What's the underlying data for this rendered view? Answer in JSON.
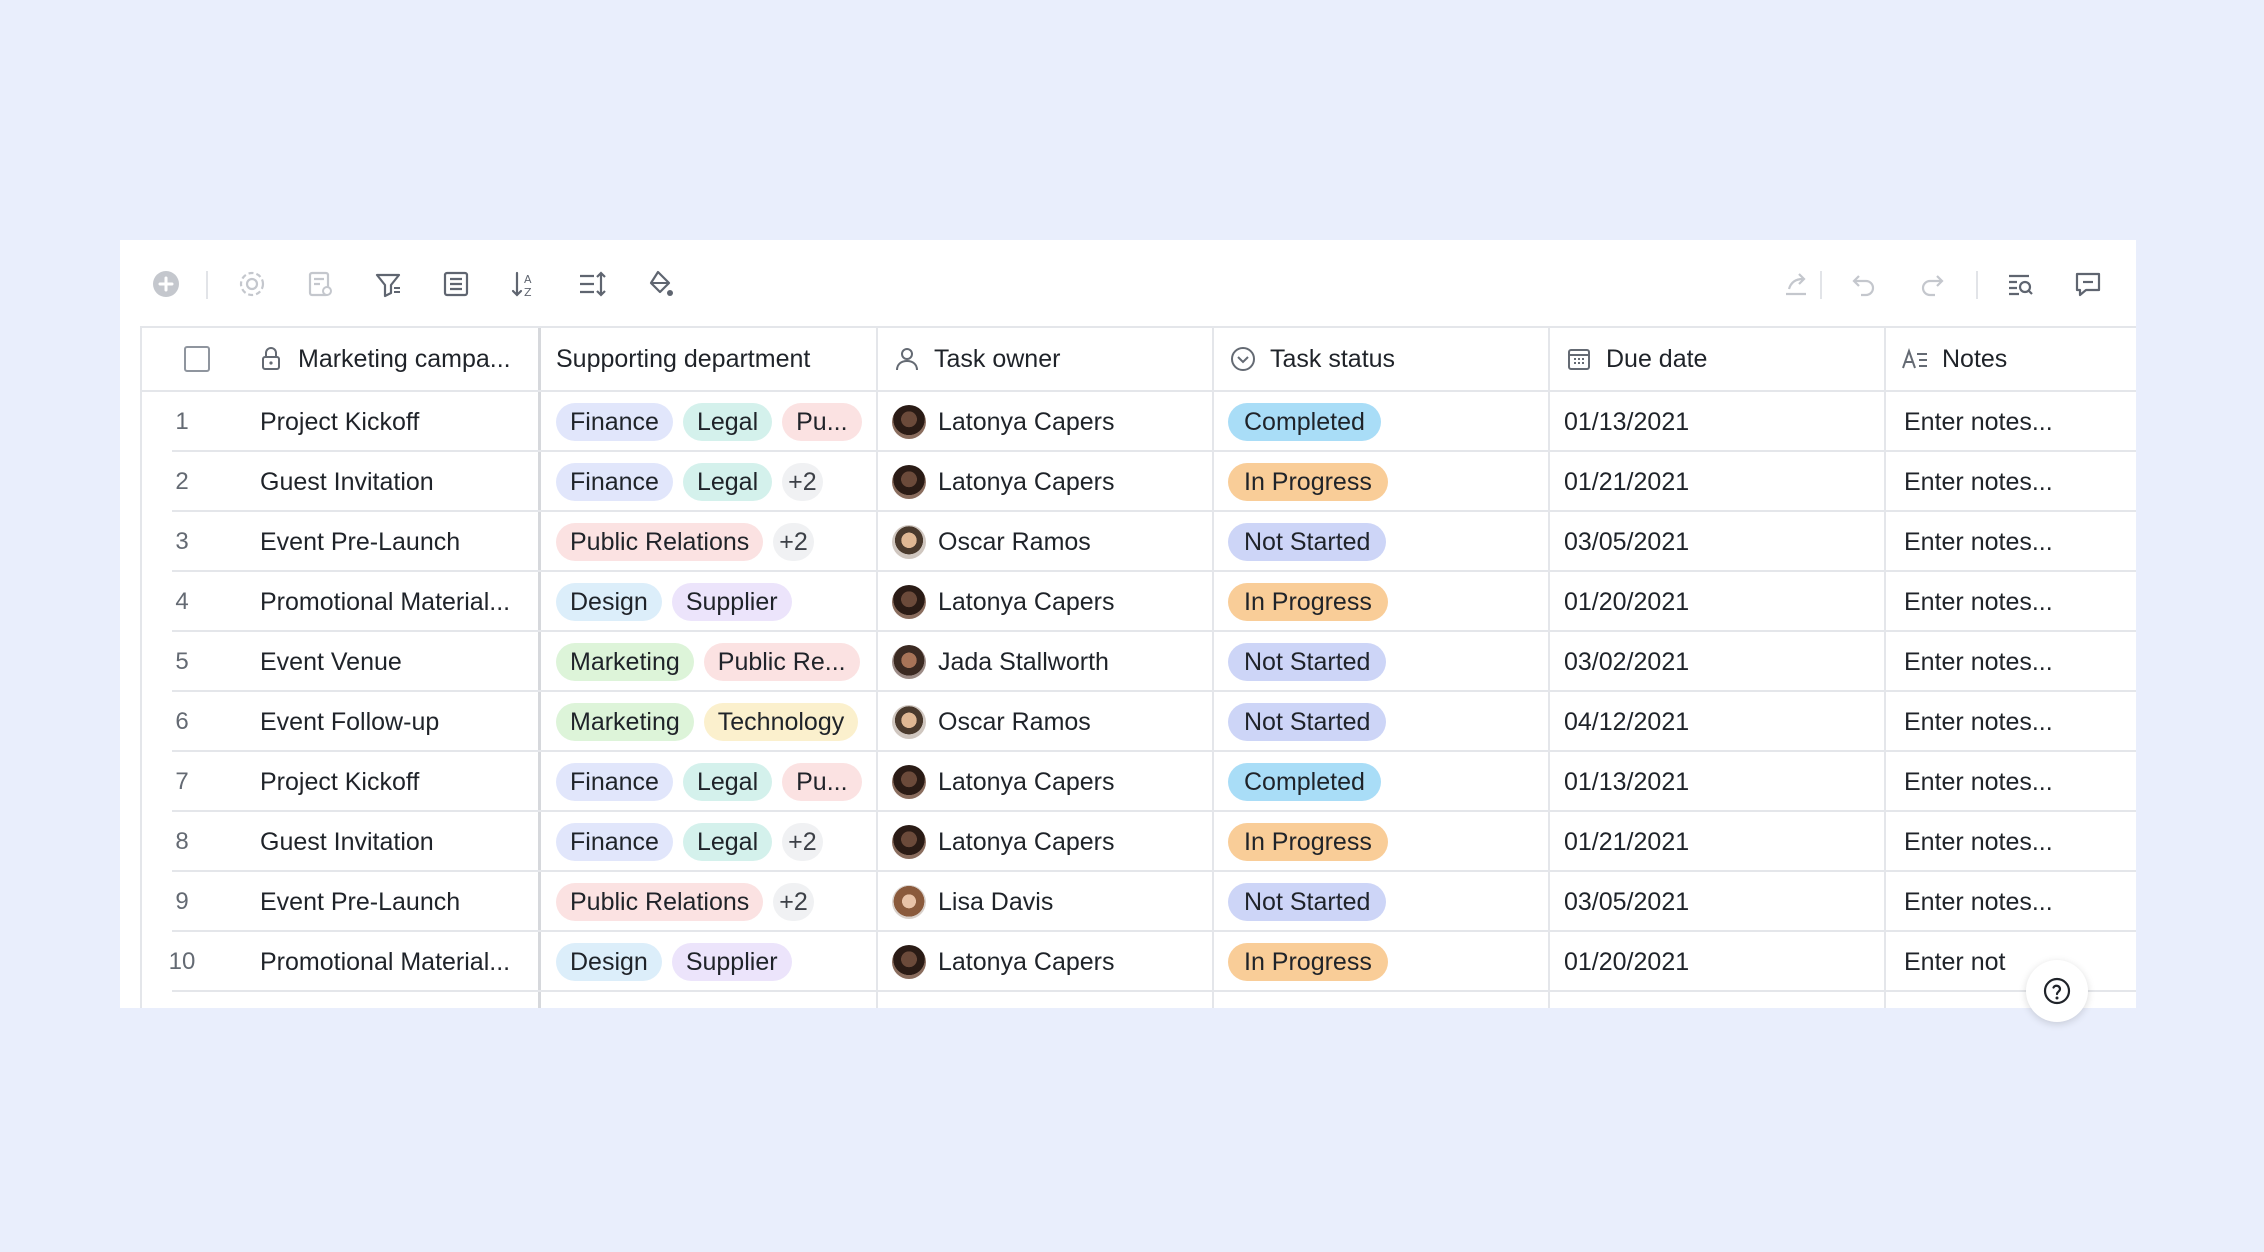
{
  "columns": [
    {
      "label": "Marketing campa...",
      "icon": "lock-icon"
    },
    {
      "label": "Supporting department",
      "icon": ""
    },
    {
      "label": "Task owner",
      "icon": "person-icon"
    },
    {
      "label": "Task status",
      "icon": "status-circle-icon"
    },
    {
      "label": "Due date",
      "icon": "calendar-icon"
    },
    {
      "label": "Notes",
      "icon": "text-icon"
    }
  ],
  "rows": [
    {
      "num": "1",
      "campaign": "Project Kickoff",
      "tags": [
        "Finance",
        "Legal",
        "Pu..."
      ],
      "more": "",
      "owner": "Latonya Capers",
      "avatar": "dark",
      "status": "Completed",
      "date": "01/13/2021",
      "notes": "Enter notes..."
    },
    {
      "num": "2",
      "campaign": "Guest Invitation",
      "tags": [
        "Finance",
        "Legal"
      ],
      "more": "+2",
      "owner": "Latonya Capers",
      "avatar": "dark",
      "status": "In Progress",
      "date": "01/21/2021",
      "notes": "Enter notes..."
    },
    {
      "num": "3",
      "campaign": "Event Pre-Launch",
      "tags": [
        "Public Relations"
      ],
      "more": "+2",
      "owner": "Oscar Ramos",
      "avatar": "light",
      "status": "Not Started",
      "date": "03/05/2021",
      "notes": "Enter notes..."
    },
    {
      "num": "4",
      "campaign": "Promotional Material...",
      "tags": [
        "Design",
        "Supplier"
      ],
      "more": "",
      "owner": "Latonya Capers",
      "avatar": "dark",
      "status": "In Progress",
      "date": "01/20/2021",
      "notes": "Enter notes..."
    },
    {
      "num": "5",
      "campaign": "Event Venue",
      "tags": [
        "Marketing",
        "Public Re..."
      ],
      "more": "",
      "owner": "Jada Stallworth",
      "avatar": "medium",
      "status": "Not Started",
      "date": "03/02/2021",
      "notes": "Enter notes..."
    },
    {
      "num": "6",
      "campaign": "Event Follow-up",
      "tags": [
        "Marketing",
        "Technology"
      ],
      "more": "",
      "owner": "Oscar Ramos",
      "avatar": "light",
      "status": "Not Started",
      "date": "04/12/2021",
      "notes": "Enter notes..."
    },
    {
      "num": "7",
      "campaign": "Project Kickoff",
      "tags": [
        "Finance",
        "Legal",
        "Pu..."
      ],
      "more": "",
      "owner": "Latonya Capers",
      "avatar": "dark",
      "status": "Completed",
      "date": "01/13/2021",
      "notes": "Enter notes..."
    },
    {
      "num": "8",
      "campaign": "Guest Invitation",
      "tags": [
        "Finance",
        "Legal"
      ],
      "more": "+2",
      "owner": "Latonya Capers",
      "avatar": "dark",
      "status": "In Progress",
      "date": "01/21/2021",
      "notes": "Enter notes..."
    },
    {
      "num": "9",
      "campaign": "Event Pre-Launch",
      "tags": [
        "Public Relations"
      ],
      "more": "+2",
      "owner": "Lisa Davis",
      "avatar": "lisa",
      "status": "Not Started",
      "date": "03/05/2021",
      "notes": "Enter notes..."
    },
    {
      "num": "10",
      "campaign": "Promotional Material...",
      "tags": [
        "Design",
        "Supplier"
      ],
      "more": "",
      "owner": "Latonya Capers",
      "avatar": "dark",
      "status": "In Progress",
      "date": "01/20/2021",
      "notes": "Enter not"
    }
  ],
  "tag_colors": {
    "Finance": "#e1e6fb",
    "Legal": "#d4f1ec",
    "Pu...": "#fbe2e2",
    "Public Relations": "#fbe2e2",
    "Public Re...": "#fbe2e2",
    "Design": "#dceefa",
    "Supplier": "#ece4fb",
    "Marketing": "#ddf4d9",
    "Technology": "#fbf0cd"
  },
  "status_colors": {
    "Completed": "#a9ddf7",
    "In Progress": "#f9cd98",
    "Not Started": "#cdd5f7"
  },
  "toolbar_icons": [
    "add-icon",
    "settings-icon",
    "form-icon",
    "filter-icon",
    "group-icon",
    "sort-icon",
    "row-height-icon",
    "fill-color-icon",
    "share-icon",
    "undo-icon",
    "redo-icon",
    "search-icon",
    "comment-icon"
  ]
}
